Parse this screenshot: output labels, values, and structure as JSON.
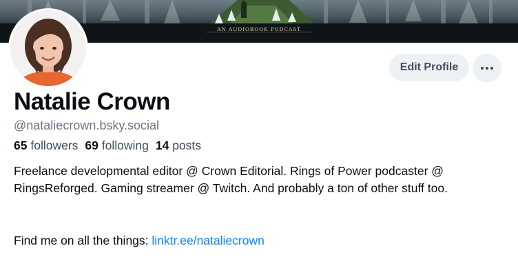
{
  "banner": {
    "caption": "AN AUDIOBOOK PODCAST"
  },
  "profile": {
    "name": "Natalie Crown",
    "handle": "@nataliecrown.bsky.social",
    "followers_count": "65",
    "followers_label": "followers",
    "following_count": "69",
    "following_label": "following",
    "posts_count": "14",
    "posts_label": "posts",
    "bio": "Freelance developmental editor @ Crown Editorial. Rings of Power podcaster @ RingsReforged. Gaming streamer @ Twitch. And probably a ton of other stuff too.",
    "find_me_text": "Find me on all the things: ",
    "link_text": "linktr.ee/nataliecrown"
  },
  "actions": {
    "edit_profile_label": "Edit Profile",
    "more_icon": "more-horizontal-icon"
  },
  "colors": {
    "accent_link": "#1083fe",
    "button_bg": "#eef1f4",
    "muted_text": "#6b7785"
  }
}
